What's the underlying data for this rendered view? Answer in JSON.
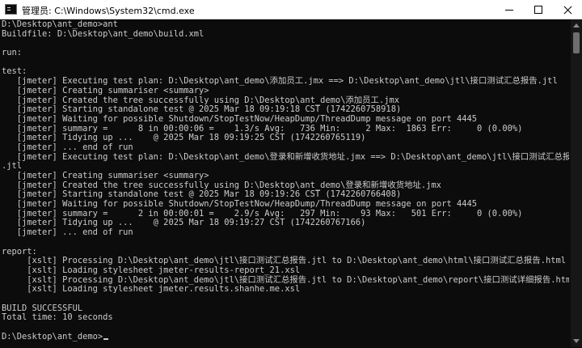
{
  "window": {
    "title": "管理员: C:\\Windows\\System32\\cmd.exe",
    "app_icon": "console-icon",
    "controls": [
      "minimize-icon",
      "maximize-icon",
      "close-icon"
    ]
  },
  "terminal": {
    "background_color": "#0c0c0c",
    "text_color": "#cccccc",
    "lines": [
      "D:\\Desktop\\ant_demo>ant",
      "Buildfile: D:\\Desktop\\ant_demo\\build.xml",
      "",
      "run:",
      "",
      "test:",
      "   [jmeter] Executing test plan: D:\\Desktop\\ant_demo\\添加员工.jmx ==> D:\\Desktop\\ant_demo\\jtl\\接口测试汇总报告.jtl",
      "   [jmeter] Creating summariser <summary>",
      "   [jmeter] Created the tree successfully using D:\\Desktop\\ant_demo\\添加员工.jmx",
      "   [jmeter] Starting standalone test @ 2025 Mar 18 09:19:18 CST (1742260758918)",
      "   [jmeter] Waiting for possible Shutdown/StopTestNow/HeapDump/ThreadDump message on port 4445",
      "   [jmeter] summary =      8 in 00:00:06 =    1.3/s Avg:   736 Min:     2 Max:  1863 Err:     0 (0.00%)",
      "   [jmeter] Tidying up ...    @ 2025 Mar 18 09:19:25 CST (1742260765119)",
      "   [jmeter] ... end of run",
      "   [jmeter] Executing test plan: D:\\Desktop\\ant_demo\\登录和新增收货地址.jmx ==> D:\\Desktop\\ant_demo\\jtl\\接口测试汇总报告",
      ".jtl",
      "   [jmeter] Creating summariser <summary>",
      "   [jmeter] Created the tree successfully using D:\\Desktop\\ant_demo\\登录和新增收货地址.jmx",
      "   [jmeter] Starting standalone test @ 2025 Mar 18 09:19:26 CST (1742260766408)",
      "   [jmeter] Waiting for possible Shutdown/StopTestNow/HeapDump/ThreadDump message on port 4445",
      "   [jmeter] summary =      2 in 00:00:01 =    2.9/s Avg:   297 Min:    93 Max:   501 Err:     0 (0.00%)",
      "   [jmeter] Tidying up ...    @ 2025 Mar 18 09:19:27 CST (1742260767166)",
      "   [jmeter] ... end of run",
      "",
      "report:",
      "     [xslt] Processing D:\\Desktop\\ant_demo\\jtl\\接口测试汇总报告.jtl to D:\\Desktop\\ant_demo\\html\\接口测试汇总报告.html",
      "     [xslt] Loading stylesheet jmeter-results-report_21.xsl",
      "     [xslt] Processing D:\\Desktop\\ant_demo\\jtl\\接口测试汇总报告.jtl to D:\\Desktop\\ant_demo\\report\\接口测试详细报告.html",
      "     [xslt] Loading stylesheet jmeter.results.shanhe.me.xsl",
      "",
      "BUILD SUCCESSFUL",
      "Total time: 10 seconds",
      "",
      "D:\\Desktop\\ant_demo>"
    ]
  },
  "scrollbar": {
    "up_icon": "scroll-up-arrow-icon",
    "down_icon": "scroll-down-arrow-icon"
  }
}
